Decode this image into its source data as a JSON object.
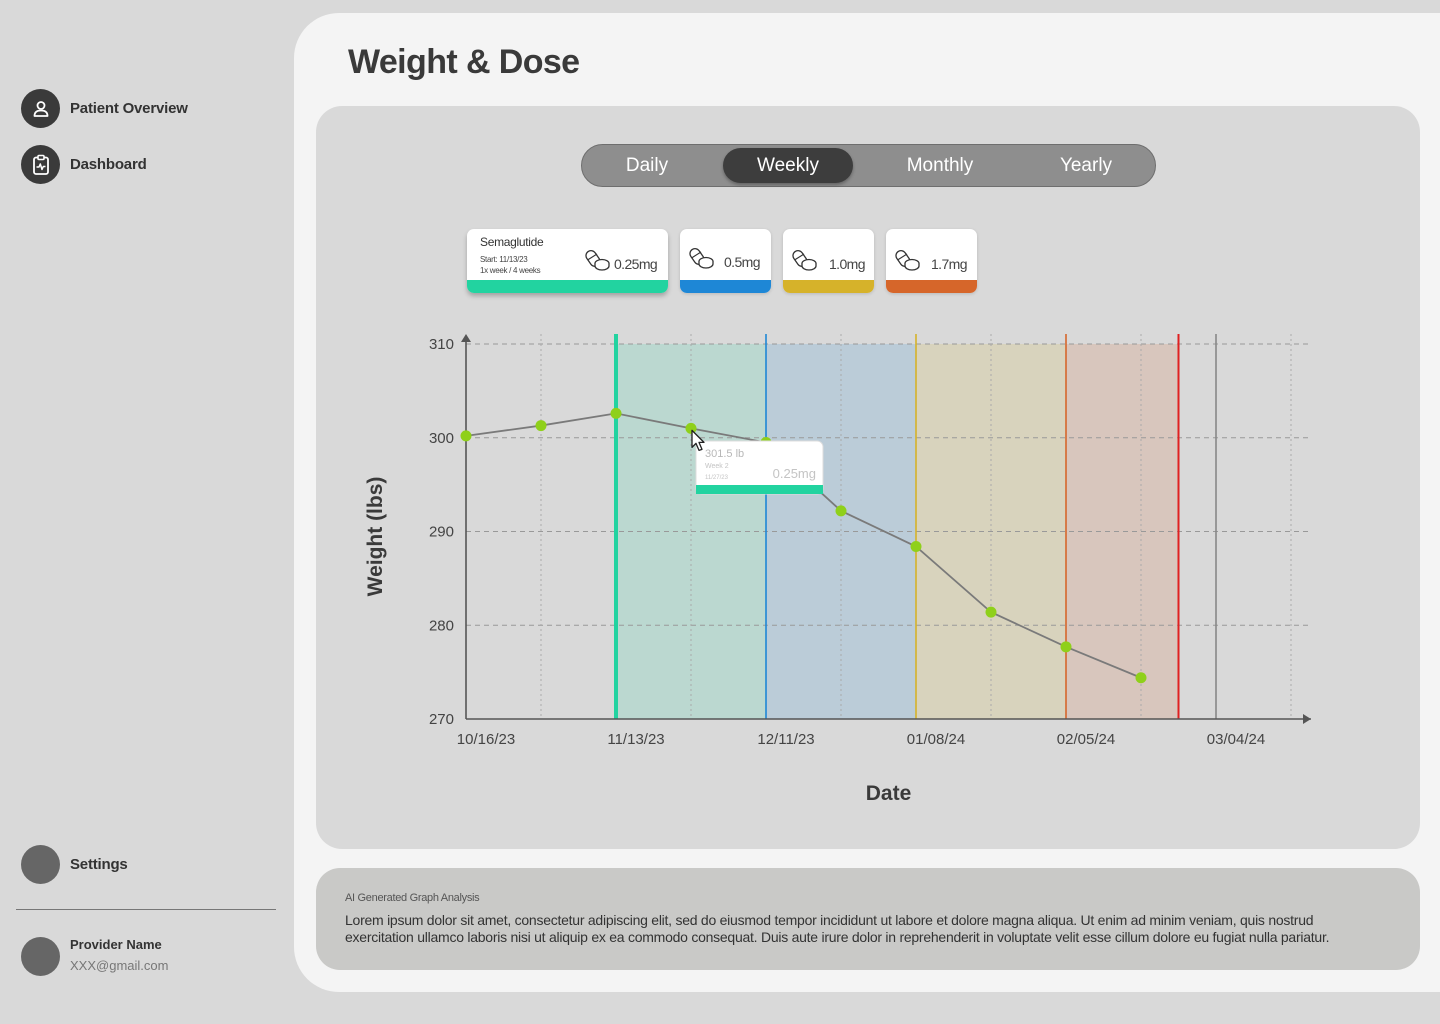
{
  "sidebar": {
    "nav": [
      {
        "label": "Patient Overview",
        "icon": "person-icon"
      },
      {
        "label": "Dashboard",
        "icon": "clipboard-pulse-icon"
      }
    ],
    "settings_label": "Settings",
    "provider": {
      "name": "Provider Name",
      "email": "XXX@gmail.com"
    }
  },
  "page": {
    "title": "Weight & Dose"
  },
  "range_tabs": {
    "items": [
      "Daily",
      "Weekly",
      "Monthly",
      "Yearly"
    ],
    "selected": "Weekly"
  },
  "dose_cards": [
    {
      "medication": "Semaglutide",
      "start": "Start: 11/13/23",
      "schedule": "1x week / 4 weeks",
      "dose": "0.25mg",
      "color": "#22d3a0",
      "icon": "pill-icon"
    },
    {
      "dose": "0.5mg",
      "color": "#1e87d6",
      "icon": "pill-icon"
    },
    {
      "dose": "1.0mg",
      "color": "#d6b22a",
      "icon": "pill-icon"
    },
    {
      "dose": "1.7mg",
      "color": "#d6662a",
      "icon": "pill-icon"
    }
  ],
  "tooltip": {
    "weight": "301.5 lb",
    "week": "Week 2",
    "date": "11/27/23",
    "dose": "0.25mg"
  },
  "analysis": {
    "title": "AI Generated Graph Analysis",
    "body": "Lorem ipsum dolor sit amet, consectetur adipiscing elit, sed do eiusmod tempor incididunt ut labore et dolore magna aliqua. Ut enim ad minim veniam, quis nostrud exercitation ullamco laboris nisi ut aliquip ex ea commodo consequat. Duis aute irure dolor in reprehenderit in voluptate velit esse cillum dolore eu fugiat nulla pariatur."
  },
  "chart_data": {
    "type": "line",
    "xlabel": "Date",
    "ylabel": "Weight (lbs)",
    "ylim": [
      270,
      310
    ],
    "yticks": [
      270,
      280,
      290,
      300,
      310
    ],
    "x_tick_labels": [
      "10/16/23",
      "11/13/23",
      "12/11/23",
      "01/08/24",
      "02/05/24",
      "03/04/24"
    ],
    "x": [
      "10/16/23",
      "10/30/23",
      "11/13/23",
      "11/27/23",
      "12/11/23",
      "12/25/23",
      "01/08/24",
      "01/22/24",
      "02/05/24",
      "02/19/24"
    ],
    "values": [
      300.2,
      301.3,
      302.6,
      301.0,
      299.5,
      292.2,
      288.4,
      281.4,
      277.7,
      274.4
    ],
    "dose_periods": [
      {
        "label": "0.25mg",
        "start": "11/13/23",
        "end": "12/11/23",
        "color": "#22d3a0"
      },
      {
        "label": "0.5mg",
        "start": "12/11/23",
        "end": "01/08/24",
        "color": "#1e87d6"
      },
      {
        "label": "1.0mg",
        "start": "01/08/24",
        "end": "02/05/24",
        "color": "#d6b22a"
      },
      {
        "label": "1.7mg",
        "start": "02/05/24",
        "end": "02/26/24",
        "color": "#d6662a"
      }
    ],
    "current_marker": {
      "date": "02/26/24",
      "color": "#e02020"
    },
    "point_color": "#8fd01a",
    "line_color": "#7a7a7a",
    "grid": true
  }
}
